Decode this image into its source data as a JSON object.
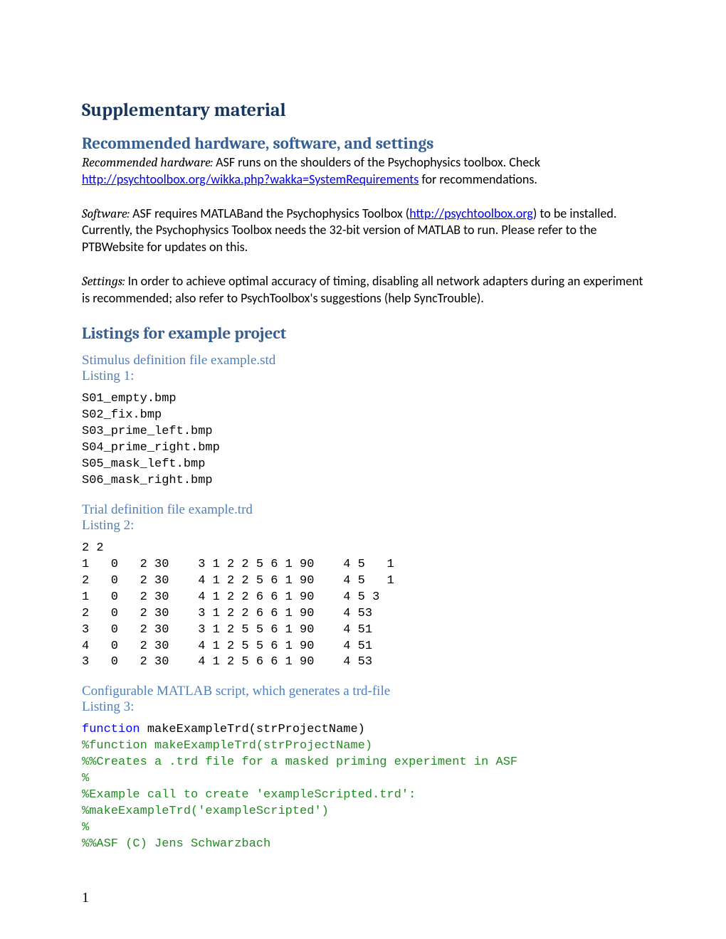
{
  "title": "Supplementary material",
  "sections": {
    "recommended": {
      "heading": "Recommended hardware, software, and settings",
      "hardware_label": "Recommended hardware:",
      "hardware_text_before": " ASF runs on the shoulders of the Psychophysics toolbox. Check ",
      "hardware_link": "http://psychtoolbox.org/wikka.php?wakka=SystemRequirements",
      "hardware_text_after": " for recommendations.",
      "software_label": "Software:",
      "software_text_before": " ASF requires MATLABand the Psychophysics Toolbox (",
      "software_link": "http://psychtoolbox.org",
      "software_text_after": ") to be installed. Currently, the Psychophysics Toolbox needs the 32-bit version of MATLAB to run. Please refer to the PTBWebsite for updates on this.",
      "settings_label": "Settings:",
      "settings_text": " In order to achieve optimal accuracy of timing, disabling all network adapters during an experiment is recommended; also refer to PsychToolbox's suggestions (help SyncTrouble)."
    },
    "listings_heading": "Listings for example project",
    "listing1": {
      "subheading": "Stimulus definition file example.std",
      "label": "Listing 1:",
      "code": "S01_empty.bmp\nS02_fix.bmp\nS03_prime_left.bmp\nS04_prime_right.bmp\nS05_mask_left.bmp\nS06_mask_right.bmp"
    },
    "listing2": {
      "subheading": "Trial definition file example.trd",
      "label": "Listing 2:",
      "code": "2 2\n1   0   2 30    3 1 2 2 5 6 1 90    4 5   1\n2   0   2 30    4 1 2 2 5 6 1 90    4 5   1\n1   0   2 30    4 1 2 2 6 6 1 90    4 5 3\n2   0   2 30    3 1 2 2 6 6 1 90    4 53\n3   0   2 30    3 1 2 5 5 6 1 90    4 51\n4   0   2 30    4 1 2 5 5 6 1 90    4 51\n3   0   2 30    4 1 2 5 6 6 1 90    4 53"
    },
    "listing3": {
      "subheading": "Configurable MATLAB script, which generates a trd-file",
      "label": "Listing 3:",
      "keyword": "function",
      "fn_decl": " makeExampleTrd(strProjectName)",
      "comments": "%function makeExampleTrd(strProjectName)\n%%Creates a .trd file for a masked priming experiment in ASF\n%\n%Example call to create 'exampleScripted.trd':\n%makeExampleTrd('exampleScripted')\n%\n%%ASF (C) Jens Schwarzbach"
    }
  },
  "page_number": "1"
}
